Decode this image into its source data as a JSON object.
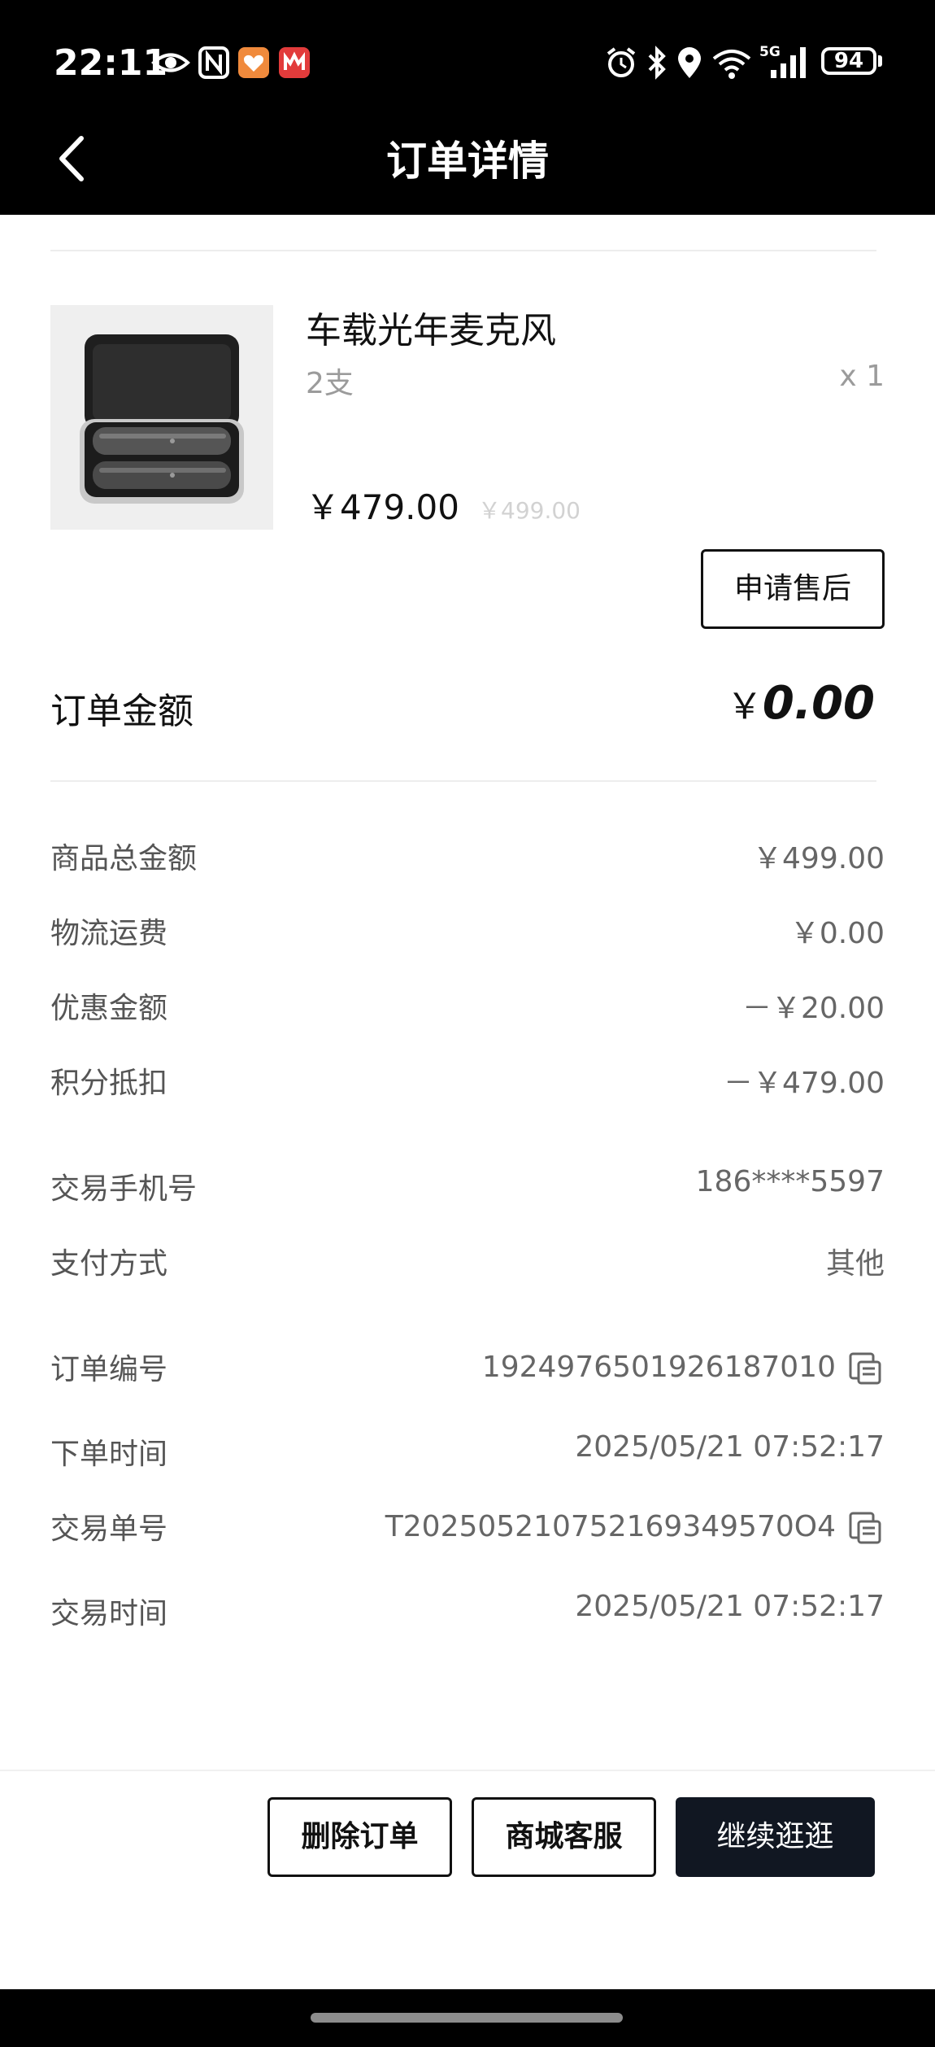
{
  "status_bar": {
    "time": "22:11",
    "battery": "94",
    "left_icons": [
      "eye-icon",
      "nfc-icon",
      "health-app-icon",
      "bank-app-icon"
    ],
    "right_icons": [
      "alarm-icon",
      "bluetooth-icon",
      "location-icon",
      "wifi-icon",
      "5g-signal-icon"
    ],
    "network_label": "5G"
  },
  "header": {
    "title": "订单详情",
    "back_icon": "chevron-left-icon"
  },
  "product": {
    "name": "车载光年麦克风",
    "spec": "2支",
    "quantity": "x 1",
    "price": "￥479.00",
    "original_price": "￥499.00",
    "after_sale_label": "申请售后"
  },
  "order_total": {
    "label": "订单金额",
    "currency": "￥",
    "amount": "0.00"
  },
  "price_rows": [
    {
      "label": "商品总金额",
      "value": "￥499.00"
    },
    {
      "label": "物流运费",
      "value": "￥0.00"
    },
    {
      "label": "优惠金额",
      "value": "－￥20.00"
    },
    {
      "label": "积分抵扣",
      "value": "－￥479.00"
    }
  ],
  "payment_rows": [
    {
      "label": "交易手机号",
      "value": "186****5597"
    },
    {
      "label": "支付方式",
      "value": "其他"
    }
  ],
  "order_info_rows": [
    {
      "label": "订单编号",
      "value": "1924976501926187010",
      "copy_icon": "copy-icon"
    },
    {
      "label": "下单时间",
      "value": "2025/05/21 07:52:17"
    },
    {
      "label": "交易单号",
      "value": "T202505210752169349570О4",
      "copy_icon": "copy-icon"
    },
    {
      "label": "交易时间",
      "value": "2025/05/21 07:52:17"
    }
  ],
  "actions": {
    "delete_label": "删除订单",
    "service_label": "商城客服",
    "continue_label": "继续逛逛"
  },
  "colors": {
    "header_bg": "#000000",
    "primary_button_bg": "#111722",
    "muted_text": "#9b9b9b",
    "original_price": "#d2d2d2"
  }
}
